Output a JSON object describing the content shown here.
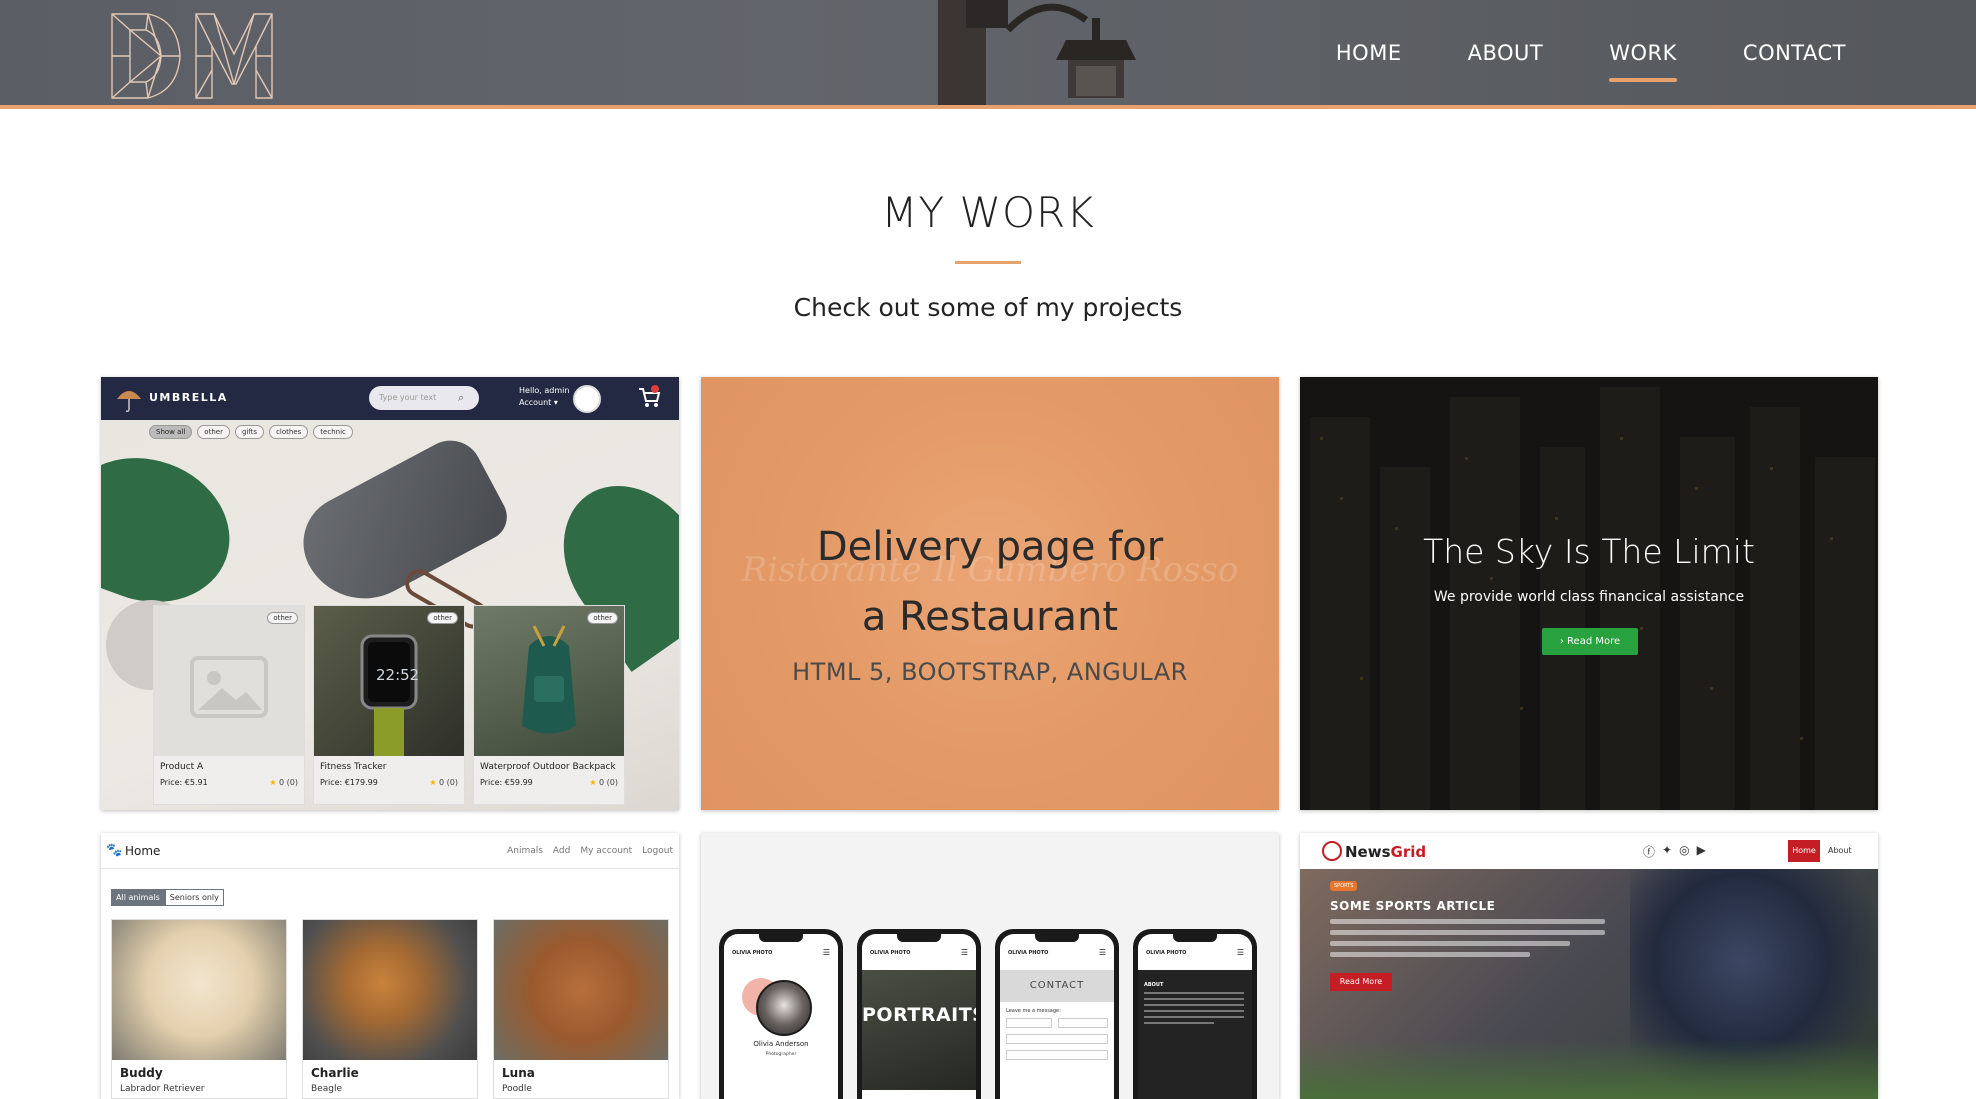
{
  "nav": {
    "items": [
      "HOME",
      "ABOUT",
      "WORK",
      "CONTACT"
    ],
    "active": "WORK"
  },
  "logo": {
    "text": "DM"
  },
  "section": {
    "title": "MY WORK",
    "subtitle": "Check out some of my projects"
  },
  "accent_color": "#e9a16b",
  "projects": {
    "umbrella": {
      "brand": "UMBRELLA",
      "search_placeholder": "Type your text",
      "greeting": "Hello, admin",
      "account": "Account ▾",
      "chips": [
        "Show all",
        "other",
        "gifts",
        "clothes",
        "technic"
      ],
      "products": [
        {
          "tag": "other",
          "name": "Product A",
          "price": "Price: €5.91",
          "rating": "0 (0)"
        },
        {
          "tag": "other",
          "name": "Fitness Tracker",
          "price": "Price: €179.99",
          "rating": "0 (0)"
        },
        {
          "tag": "other",
          "name": "Waterproof Outdoor Backpack",
          "price": "Price: €59.99",
          "rating": "0 (0)"
        }
      ]
    },
    "restaurant": {
      "ghost_text": "Ristorante Il Gambero Rosso",
      "title_line1": "Delivery page for",
      "title_line2": "a Restaurant",
      "tech": "HTML 5, BOOTSTRAP, ANGULAR",
      "overlay_color": "#e59a65"
    },
    "finance": {
      "title": "The Sky Is The Limit",
      "subtitle": "We provide world class financical assistance",
      "button": "› Read More",
      "button_color": "#27a23e"
    },
    "animals": {
      "home": "Home",
      "links": [
        "Animals",
        "Add",
        "My account",
        "Logout"
      ],
      "tabs": [
        "All animals",
        "Seniors only"
      ],
      "pets": [
        {
          "name": "Buddy",
          "breed": "Labrador Retriever"
        },
        {
          "name": "Charlie",
          "breed": "Beagle"
        },
        {
          "name": "Luna",
          "breed": "Poodle"
        }
      ]
    },
    "photo": {
      "brand": "OLIVIA PHOTO",
      "person": "Olivia Anderson",
      "role": "Photographer",
      "portraits": "PORTRAITS",
      "contact": "CONTACT",
      "contact_prompt": "Leave me a message:",
      "about": "ABOUT"
    },
    "news": {
      "brand_a": "News",
      "brand_b": "Grid",
      "badge": "SPORTS",
      "headline": "SOME SPORTS ARTICLE",
      "read_more": "Read More",
      "nav_home": "Home",
      "nav_about": "About",
      "brand_color": "#c51d24"
    }
  }
}
